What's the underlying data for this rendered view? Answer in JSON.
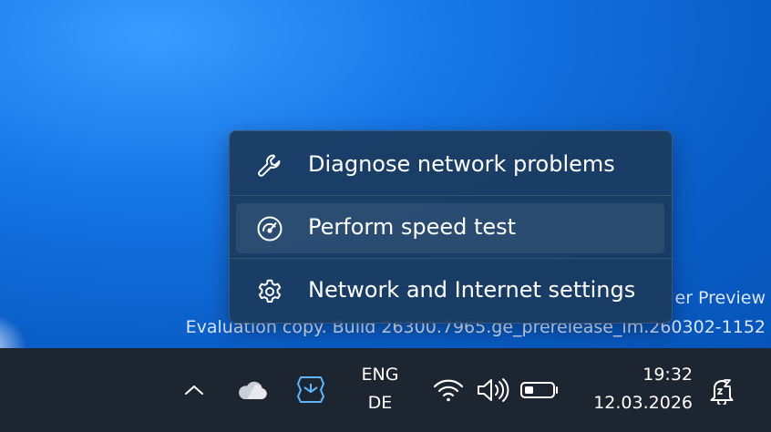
{
  "watermark": {
    "line1": "er Preview",
    "line2": "Evaluation copy. Build 26300.7965.ge_prerelease_im.260302-1152"
  },
  "context_menu": {
    "items": [
      {
        "label": "Diagnose network problems",
        "icon": "wrench-icon"
      },
      {
        "label": "Perform speed test",
        "icon": "speedometer-icon",
        "hovered": true
      },
      {
        "label": "Network and Internet settings",
        "icon": "gear-icon"
      }
    ]
  },
  "taskbar": {
    "language": {
      "primary": "ENG",
      "secondary": "DE"
    },
    "clock": {
      "time": "19:32",
      "date": "12.03.2026"
    },
    "icons": [
      "chevron-up-icon",
      "onedrive-cloud-icon",
      "copilot-icon",
      "wifi-icon",
      "volume-icon",
      "battery-icon",
      "notification-do-not-disturb-icon"
    ]
  },
  "colors": {
    "desktop": "#1676e6",
    "menu_background": "#1b3a5c",
    "taskbar": "#1d2630",
    "copilot_accent": "#5fb6ff"
  }
}
